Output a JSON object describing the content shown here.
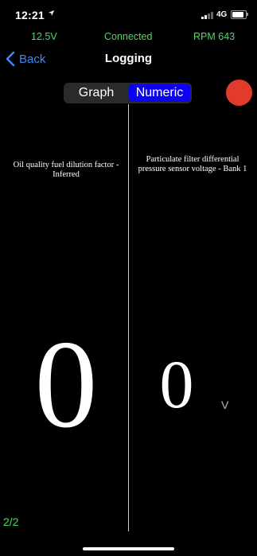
{
  "status_bar": {
    "time": "12:21",
    "location_arrow": "location-arrow-icon",
    "network": "4G"
  },
  "info_row": {
    "voltage": "12.5V",
    "connection": "Connected",
    "rpm": "RPM 643",
    "color": "#4cd964"
  },
  "nav": {
    "back_label": "Back",
    "title": "Logging",
    "accent": "#3d8af7"
  },
  "segmented": {
    "options": [
      "Graph",
      "Numeric"
    ],
    "selected": "Numeric",
    "selected_color": "#0c00f5"
  },
  "record_button": {
    "color": "#e23b2e"
  },
  "readouts": [
    {
      "label": "Oil quality fuel dilution factor  -  Inferred",
      "value": "0",
      "unit": ""
    },
    {
      "label": "Particulate filter differential pressure sensor voltage  -  Bank 1",
      "value": "0",
      "unit": "V"
    }
  ],
  "pager": {
    "text": "2/2"
  }
}
